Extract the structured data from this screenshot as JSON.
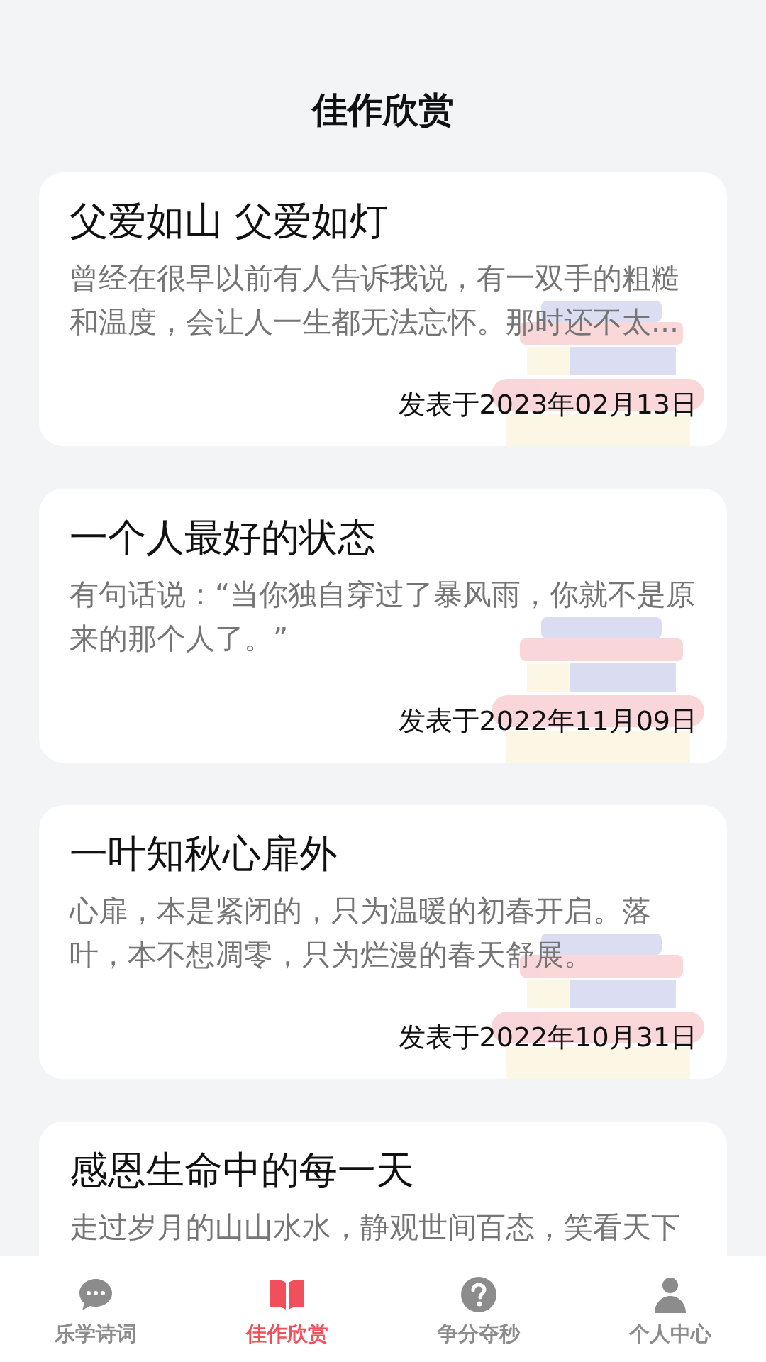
{
  "header": {
    "title": "佳作欣赏"
  },
  "articles": [
    {
      "title": "父爱如山 父爱如灯",
      "excerpt": "曾经在很早以前有人告诉我说，有一双手的粗糙和温度，会让人一生都无法忘怀。那时还不太...",
      "date": "发表于2023年02月13日"
    },
    {
      "title": "一个人最好的状态",
      "excerpt": "有句话说：“当你独自穿过了暴风雨，你就不是原来的那个人了。”",
      "date": "发表于2022年11月09日"
    },
    {
      "title": "一叶知秋心扉外",
      "excerpt": "心扉，本是紧闭的，只为温暖的初春开启。落叶，本不想凋零，只为烂漫的春天舒展。",
      "date": "发表于2022年10月31日"
    },
    {
      "title": "感恩生命中的每一天",
      "excerpt": "走过岁月的山山水水，静观世间百态，笑看天下"
    }
  ],
  "tab_bar": [
    {
      "label": "乐学诗词",
      "selected": false
    },
    {
      "label": "佳作欣赏",
      "selected": true
    },
    {
      "label": "争分夺秒",
      "selected": false
    },
    {
      "label": "个人中心",
      "selected": false
    }
  ]
}
